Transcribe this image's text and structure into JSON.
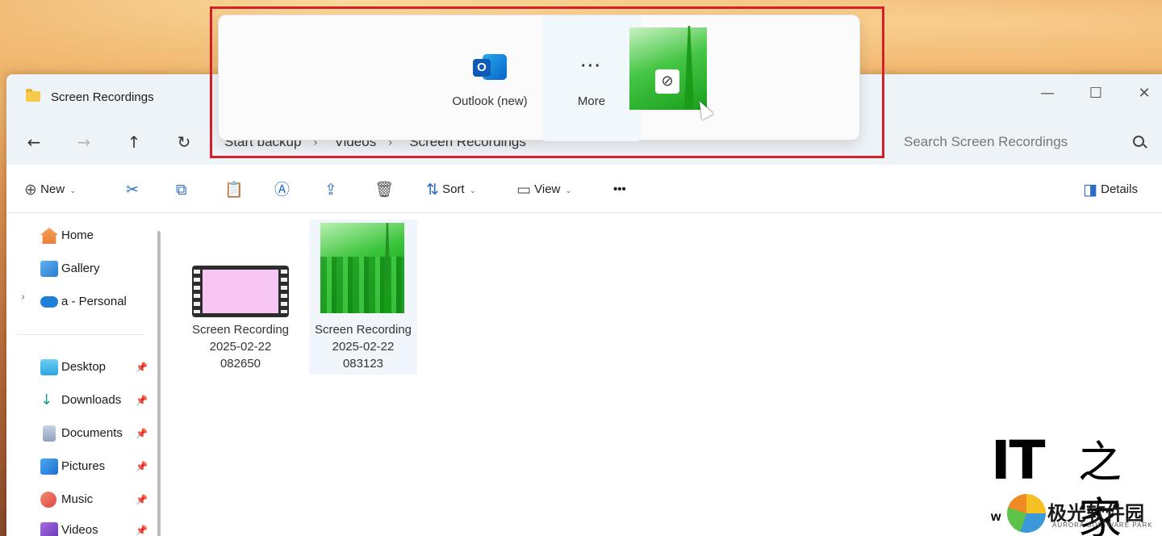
{
  "window": {
    "title": "Screen Recordings",
    "controls": {
      "minimize": "—",
      "maximize": "☐",
      "close": "✕"
    }
  },
  "nav": {
    "back": "←",
    "forward": "→",
    "up": "↑",
    "refresh": "↻",
    "breadcrumb": [
      "Start backup",
      "Videos",
      "Screen Recordings"
    ],
    "separator": "›",
    "search_placeholder": "Search Screen Recordings"
  },
  "toolbar": {
    "new_label": "New",
    "cut_icon": "✂",
    "copy_icon": "⧉",
    "paste_icon": "📋",
    "rename_icon": "Ⓐ",
    "share_icon": "⇪",
    "delete_icon": "🗑",
    "sort_label": "Sort",
    "view_label": "View",
    "more_label": "•••",
    "details_label": "Details"
  },
  "sidebar": {
    "items": [
      {
        "label": "Home",
        "pinned": false
      },
      {
        "label": "Gallery",
        "pinned": false
      },
      {
        "label": "a - Personal",
        "pinned": false
      },
      {
        "label": "Desktop",
        "pinned": true
      },
      {
        "label": "Downloads",
        "pinned": true
      },
      {
        "label": "Documents",
        "pinned": true
      },
      {
        "label": "Pictures",
        "pinned": true
      },
      {
        "label": "Music",
        "pinned": true
      },
      {
        "label": "Videos",
        "pinned": true
      }
    ]
  },
  "files": [
    {
      "line1": "Screen Recording",
      "line2": "2025-02-22",
      "line3": "082650",
      "selected": false
    },
    {
      "line1": "Screen Recording",
      "line2": "2025-02-22",
      "line3": "083123",
      "selected": true
    }
  ],
  "share": {
    "targets": [
      {
        "label": "Outlook (new)",
        "icon": "outlook-icon"
      },
      {
        "label": "More",
        "icon": "more-icon",
        "dots": "···"
      }
    ],
    "blocked_icon": "⊘",
    "highlight_color": "#d42027"
  },
  "watermark": {
    "it": "IT",
    "zh": "之家",
    "w": "w",
    "cn": "极光软件园",
    "en": "AURORA SOFTWARE PARK"
  }
}
